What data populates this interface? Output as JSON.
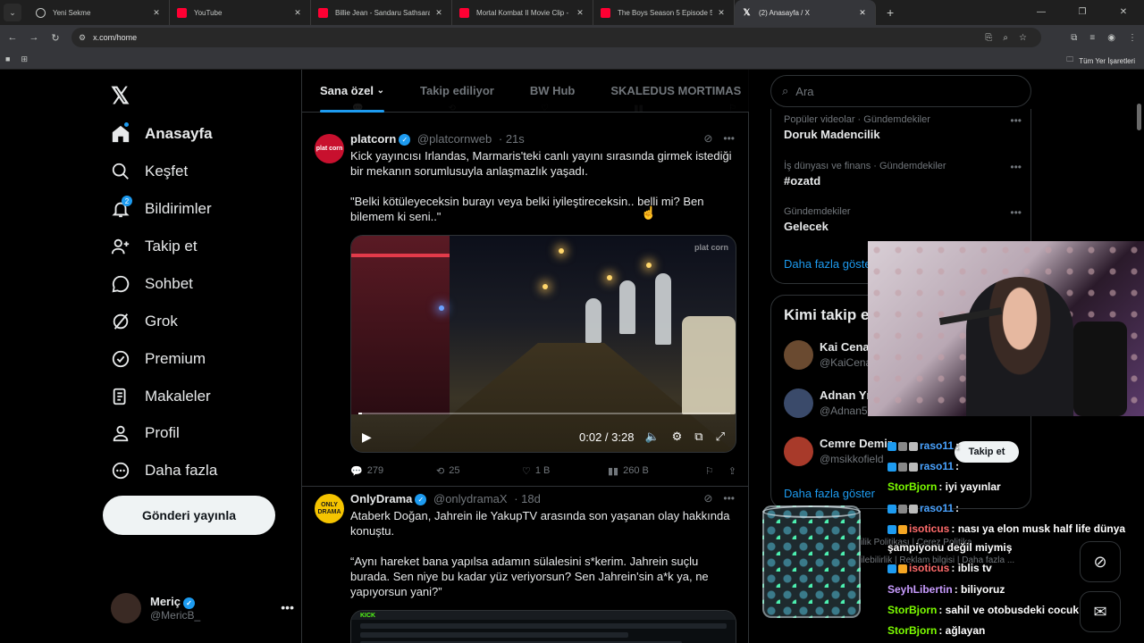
{
  "browser": {
    "tabs": [
      {
        "title": "Yeni Sekme",
        "icon": "globe-icon",
        "active": false
      },
      {
        "title": "YouTube",
        "icon": "youtube-icon",
        "active": false
      },
      {
        "title": "Billie Jean - Sandaru Sathsara - ",
        "icon": "youtube-icon",
        "active": false
      },
      {
        "title": "Mortal Kombat II Movie Clip - ",
        "icon": "youtube-icon",
        "active": false
      },
      {
        "title": "The Boys Season 5 Episode 5 T",
        "icon": "youtube-icon",
        "active": false
      },
      {
        "title": "(2) Anasayfa / X",
        "icon": "x-icon",
        "active": true
      }
    ],
    "url": "x.com/home",
    "bookmarks_all": "Tüm Yer İşaretleri"
  },
  "nav": {
    "items": [
      {
        "label": "Anasayfa",
        "icon": "home-icon"
      },
      {
        "label": "Keşfet",
        "icon": "search-icon"
      },
      {
        "label": "Bildirimler",
        "icon": "bell-icon",
        "badge": "2"
      },
      {
        "label": "Takip et",
        "icon": "add-person-icon"
      },
      {
        "label": "Sohbet",
        "icon": "chat-icon"
      },
      {
        "label": "Grok",
        "icon": "grok-icon"
      },
      {
        "label": "Premium",
        "icon": "verified-icon"
      },
      {
        "label": "Makaleler",
        "icon": "articles-icon"
      },
      {
        "label": "Profil",
        "icon": "person-icon"
      },
      {
        "label": "Daha fazla",
        "icon": "more-circle-icon"
      }
    ],
    "post_button": "Gönderi yayınla",
    "account": {
      "name": "Meriç",
      "handle": "@MericB_"
    }
  },
  "feed": {
    "tabs": [
      "Sana özel",
      "Takip ediliyor",
      "BW Hub",
      "SKALEDUS MORTIMAS"
    ],
    "posts": [
      {
        "name": "platcorn",
        "handle": "@platcornweb",
        "time": "21s",
        "avatar_text": "plat corn",
        "text1": "Kick yayıncısı Irlandas, Marmaris'teki canlı yayını sırasında girmek istediği bir mekanın sorumlusuyla anlaşmazlık yaşadı.",
        "text2": "\"Belki kötüleyeceksin burayı veya belki iyileştireceksin.. belli mi? Ben bilemem ki seni..\"",
        "video": {
          "time": "0:02 / 3:28",
          "progress": 0.01,
          "watermark": "plat corn"
        },
        "replies": "279",
        "reposts": "25",
        "likes": "1 B",
        "views": "260 B"
      },
      {
        "name": "OnlyDrama",
        "handle": "@onlydramaX",
        "time": "18d",
        "avatar_text": "ONLY DRAMA",
        "text1": "Ataberk Doğan, Jahrein ile YakupTV arasında son yaşanan olay hakkında konuştu.",
        "text2": "“Aynı hareket bana yapılsa adamın sülalesini s*kerim. Jahrein suçlu burada. Sen niye bu kadar yüz veriyorsun? Sen Jahrein'sin a*k ya, ne yapıyorsun yani?”",
        "thumb_label": "KICK"
      }
    ]
  },
  "sidebar": {
    "search_placeholder": "Ara",
    "trends": [
      {
        "context": "Popüler videolar · Gündemdekiler",
        "title": "Doruk Madencilik"
      },
      {
        "context": "İş dünyası ve finans · Gündemdekiler",
        "title": "#ozatd"
      },
      {
        "context": "Gündemdekiler",
        "title": "Gelecek"
      }
    ],
    "show_more": "Daha fazla göste",
    "follow_title": "Kimi takip e",
    "suggestions": [
      {
        "name": "Kai Cenat",
        "handle": "@KaiCena"
      },
      {
        "name": "Adnan Yıl",
        "handle": "@Adnan5"
      },
      {
        "name": "Cemre Demir",
        "handle": "@msikkofield"
      }
    ],
    "follow_button": "Takip et",
    "follow_show_more": "Daha fazla göster",
    "footer": [
      "Gizlilik Politikası",
      "Çerez Politika",
      "Erişilebilirlik",
      "Reklam bilgisi",
      "Daha fazla ..."
    ]
  },
  "stream_chat": [
    {
      "user": "raso11",
      "msg": ":",
      "color": "#4aa3ff"
    },
    {
      "user": "raso11",
      "msg": ":",
      "color": "#4aa3ff"
    },
    {
      "user": "StorBjorn",
      "msg": ": iyi yayınlar",
      "color": "#7CFC00"
    },
    {
      "user": "raso11",
      "msg": ":",
      "color": "#4aa3ff"
    },
    {
      "user": "isoticus",
      "msg": ": nası ya elon musk half life dünya",
      "color": "#ff6b6b"
    },
    {
      "user": "",
      "msg": "şampiyonu değil miymiş",
      "color": "#ffffff"
    },
    {
      "user": "isoticus",
      "msg": ": iblis tv",
      "color": "#ff6b6b"
    },
    {
      "user": "SeyhLibertin",
      "msg": ": biliyoruz",
      "color": "#c99cff"
    },
    {
      "user": "StorBjorn",
      "msg": ": sahil ve otobusdeki cocuk mu",
      "color": "#7CFC00"
    },
    {
      "user": "StorBjorn",
      "msg": ": ağlayan",
      "color": "#7CFC00"
    }
  ],
  "colors": {
    "accent": "#1d9bf0",
    "background": "#000000",
    "border": "#2f3336",
    "muted": "#71767b"
  }
}
